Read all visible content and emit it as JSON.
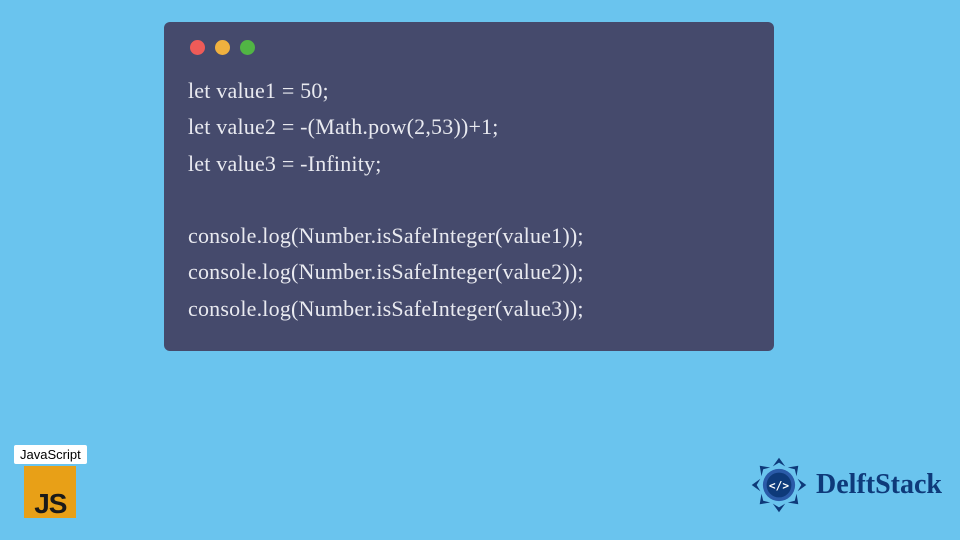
{
  "code": {
    "lines": [
      "let value1 = 50;",
      "let value2 = -(Math.pow(2,53))+1;",
      "let value3 = -Infinity;",
      "",
      "console.log(Number.isSafeInteger(value1));",
      "console.log(Number.isSafeInteger(value2));",
      "console.log(Number.isSafeInteger(value3));"
    ]
  },
  "window": {
    "dot_colors": {
      "red": "#ee5b58",
      "yellow": "#f0b13f",
      "green": "#51b544"
    }
  },
  "badges": {
    "js_label": "JavaScript",
    "js_logo_text": "JS",
    "delft_text": "DelftStack"
  },
  "colors": {
    "page_bg": "#6ac4ee",
    "window_bg": "#454a6c",
    "code_fg": "#e9eaf0",
    "js_logo_bg": "#e8a017",
    "delft_primary": "#0e3a7a"
  }
}
